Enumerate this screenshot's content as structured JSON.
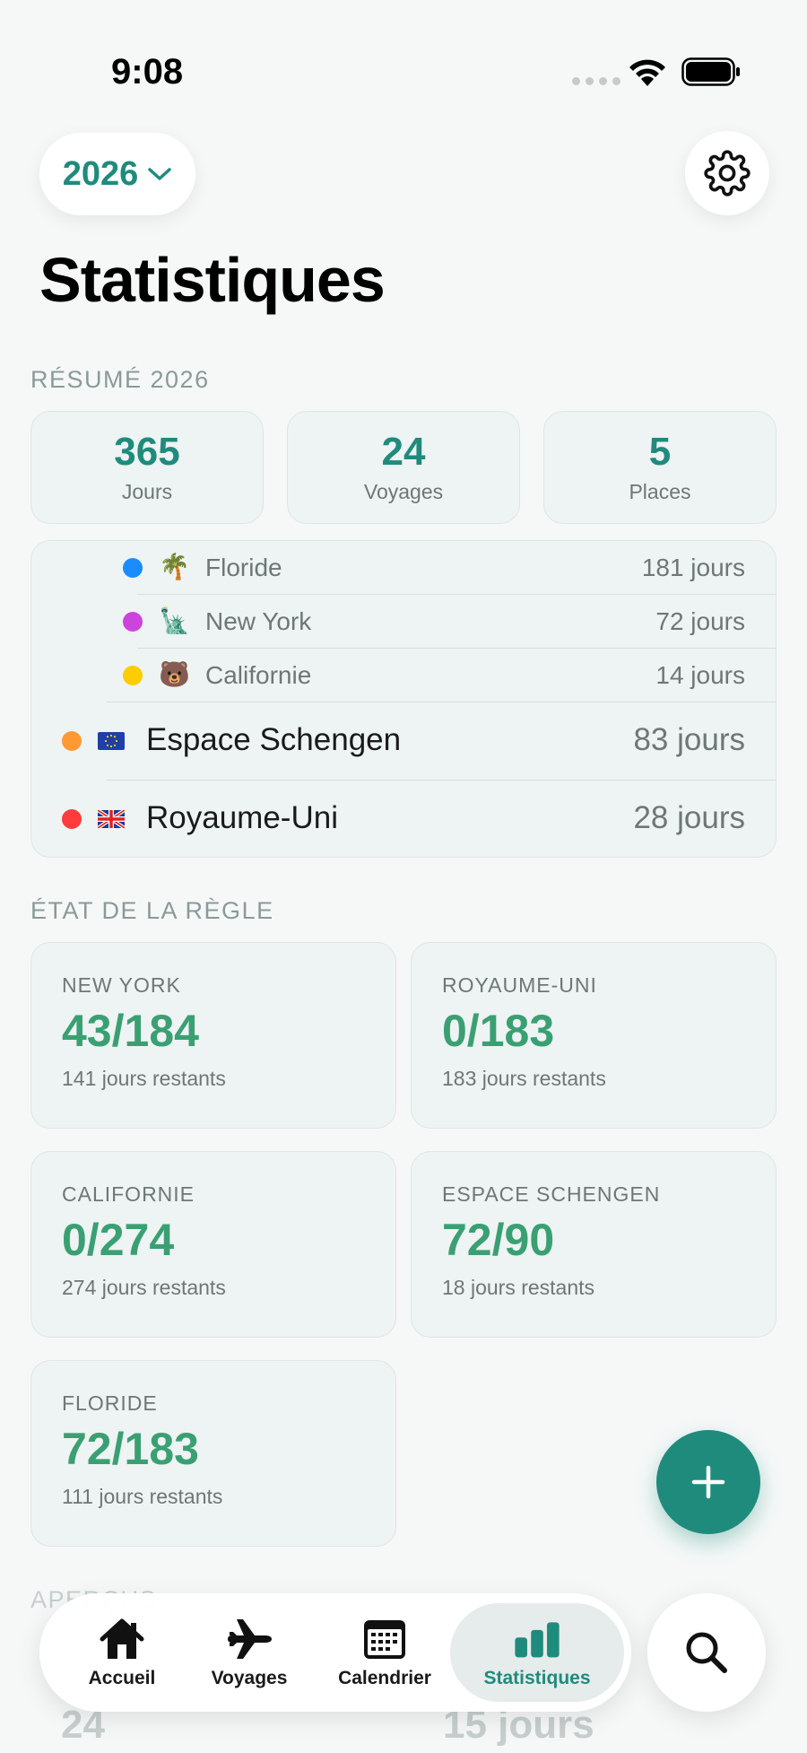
{
  "status_bar": {
    "time": "9:08"
  },
  "header": {
    "year": "2026",
    "title": "Statistiques"
  },
  "summary": {
    "section_title": "RÉSUMÉ 2026",
    "cards": [
      {
        "value": "365",
        "label": "Jours"
      },
      {
        "value": "24",
        "label": "Voyages"
      },
      {
        "value": "5",
        "label": "Places"
      }
    ]
  },
  "locations": [
    {
      "name": "Floride",
      "days": "181 jours",
      "dot_color": "#1a8cff",
      "emoji": "🌴"
    },
    {
      "name": "New York",
      "days": "72 jours",
      "dot_color": "#cc44dd",
      "emoji": "🗽"
    },
    {
      "name": "Californie",
      "days": "14 jours",
      "dot_color": "#ffcc00",
      "emoji": "🐻"
    },
    {
      "name": "Espace Schengen",
      "days": "83 jours",
      "dot_color": "#ff9933",
      "flag": "eu-flag-icon"
    },
    {
      "name": "Royaume-Uni",
      "days": "28 jours",
      "dot_color": "#ff3b3b",
      "flag": "uk-flag-icon"
    }
  ],
  "rules": {
    "section_title": "ÉTAT DE LA RÈGLE",
    "cards": [
      {
        "name": "NEW YORK",
        "value": "43/184",
        "remaining": "141 jours restants"
      },
      {
        "name": "ROYAUME-UNI",
        "value": "0/183",
        "remaining": "183 jours restants"
      },
      {
        "name": "CALIFORNIE",
        "value": "0/274",
        "remaining": "274 jours restants"
      },
      {
        "name": "ESPACE SCHENGEN",
        "value": "72/90",
        "remaining": "18 jours restants"
      },
      {
        "name": "FLORIDE",
        "value": "72/183",
        "remaining": "111 jours restants"
      }
    ]
  },
  "overview": {
    "section_title_partial": "APERÇUS",
    "value_left": "24",
    "value_right": "15 jours"
  },
  "tabs": [
    {
      "label": "Accueil",
      "icon": "home-icon"
    },
    {
      "label": "Voyages",
      "icon": "airplane-icon"
    },
    {
      "label": "Calendrier",
      "icon": "calendar-icon"
    },
    {
      "label": "Statistiques",
      "icon": "bar-chart-icon",
      "active": true
    }
  ],
  "colors": {
    "accent": "#1f8b7c",
    "rule_green": "#3aa073"
  }
}
